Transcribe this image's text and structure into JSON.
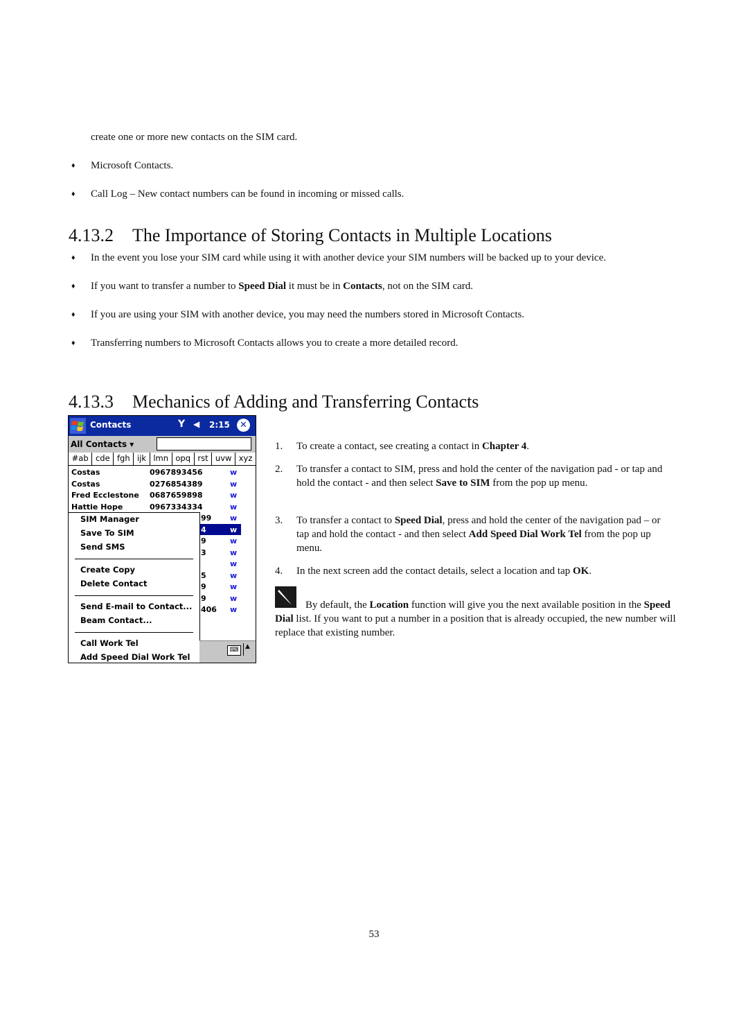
{
  "intro": {
    "continuation": "create one or more new contacts on the SIM card.",
    "bullets": [
      "Microsoft Contacts.",
      "Call Log – New contact numbers can be found in incoming or missed calls."
    ]
  },
  "section_4132": {
    "number": "4.13.2",
    "title": "The Importance of Storing Contacts in Multiple Locations",
    "bullets": [
      {
        "segments": [
          {
            "text": "In the event you lose your SIM card while using it with another device your SIM numbers will be backed up to your device.",
            "bold": false
          }
        ]
      },
      {
        "segments": [
          {
            "text": "If you want to transfer a number to ",
            "bold": false
          },
          {
            "text": "Speed Dial",
            "bold": true
          },
          {
            "text": " it must be in ",
            "bold": false
          },
          {
            "text": "Contacts",
            "bold": true
          },
          {
            "text": ", not on the SIM card.",
            "bold": false
          }
        ]
      },
      {
        "segments": [
          {
            "text": "If you are using your SIM with another device, you may need the numbers stored in Microsoft Contacts.",
            "bold": false
          }
        ]
      },
      {
        "segments": [
          {
            "text": "Transferring numbers to Microsoft Contacts allows you to create a more detailed record.",
            "bold": false
          }
        ]
      }
    ]
  },
  "section_4133": {
    "number": "4.13.3",
    "title": "Mechanics of Adding and Transferring Contacts"
  },
  "bullet_glyph": "♦",
  "device": {
    "app_title": "Contacts",
    "signal_icon": "antenna-icon",
    "signal_glyph": "Y",
    "volume_glyph": "◀",
    "time": "2:15",
    "close_glyph": "✕",
    "filter_label": "All Contacts ▾",
    "search_value": "",
    "alpha_tabs": [
      "#ab",
      "cde",
      "fgh",
      "ijk",
      "lmn",
      "opq",
      "rst",
      "uvw",
      "xyz"
    ],
    "contacts": [
      {
        "name": "Costas",
        "phone": "0967893456",
        "type": "w"
      },
      {
        "name": "Costas",
        "phone": "0276854389",
        "type": "w"
      },
      {
        "name": "Fred Ecclestone",
        "phone": "0687659898",
        "type": "w"
      },
      {
        "name": "Hattie Hope",
        "phone": "0967334334",
        "type": "w"
      }
    ],
    "partial_rows": [
      {
        "phone_fragment": "99",
        "type": "w"
      },
      {
        "phone_fragment": "4",
        "type": "w",
        "selected": true
      },
      {
        "phone_fragment": "9",
        "type": "w"
      },
      {
        "phone_fragment": "3",
        "type": "w"
      },
      {
        "phone_fragment": "",
        "type": "w"
      },
      {
        "phone_fragment": "5",
        "type": "w"
      },
      {
        "phone_fragment": "9",
        "type": "w"
      },
      {
        "phone_fragment": "9",
        "type": "w"
      },
      {
        "phone_fragment": "406",
        "type": "w"
      }
    ],
    "menu_groups": [
      [
        "SIM Manager",
        "Save To SIM",
        "Send SMS"
      ],
      [
        "Create Copy",
        "Delete Contact"
      ],
      [
        "Send E-mail to Contact...",
        "Beam Contact..."
      ],
      [
        "Call Work Tel",
        "Add Speed Dial Work Tel"
      ]
    ],
    "keyboard_glyph": "⌨",
    "arrow_glyph": "▲"
  },
  "steps": [
    {
      "n": "1.",
      "segments": [
        {
          "text": "To create a contact, see creating a contact in ",
          "bold": false
        },
        {
          "text": "Chapter 4",
          "bold": true
        },
        {
          "text": ".",
          "bold": false
        }
      ]
    },
    {
      "n": "2.",
      "segments": [
        {
          "text": "To transfer a contact to SIM, press and hold the center of the navigation pad - or tap and hold the contact - and then select ",
          "bold": false
        },
        {
          "text": "Save to SIM",
          "bold": true
        },
        {
          "text": " from the pop up menu.",
          "bold": false
        }
      ]
    },
    {
      "n": "3.",
      "segments": [
        {
          "text": "To transfer a contact to ",
          "bold": false
        },
        {
          "text": "Speed Dial",
          "bold": true
        },
        {
          "text": ", press and hold the center of the navigation pad – or tap and hold the contact - and then select ",
          "bold": false
        },
        {
          "text": "Add Speed Dial Work Tel",
          "bold": true
        },
        {
          "text": " from the pop up menu.",
          "bold": false
        }
      ]
    },
    {
      "n": "4.",
      "segments": [
        {
          "text": "In the next screen add the contact details, select a location and tap ",
          "bold": false
        },
        {
          "text": "OK",
          "bold": true
        },
        {
          "text": ".",
          "bold": false
        }
      ]
    }
  ],
  "note": {
    "icon": "pen-note-icon",
    "segments": [
      {
        "text": "By default, the ",
        "bold": false
      },
      {
        "text": "Location",
        "bold": true
      },
      {
        "text": " function will give you the next available position in the ",
        "bold": false
      },
      {
        "text": "Speed Dial",
        "bold": true
      },
      {
        "text": " list. If you want to put a number in a position that is already occupied, the new number will replace that existing number.",
        "bold": false
      }
    ]
  },
  "page_number": "53"
}
